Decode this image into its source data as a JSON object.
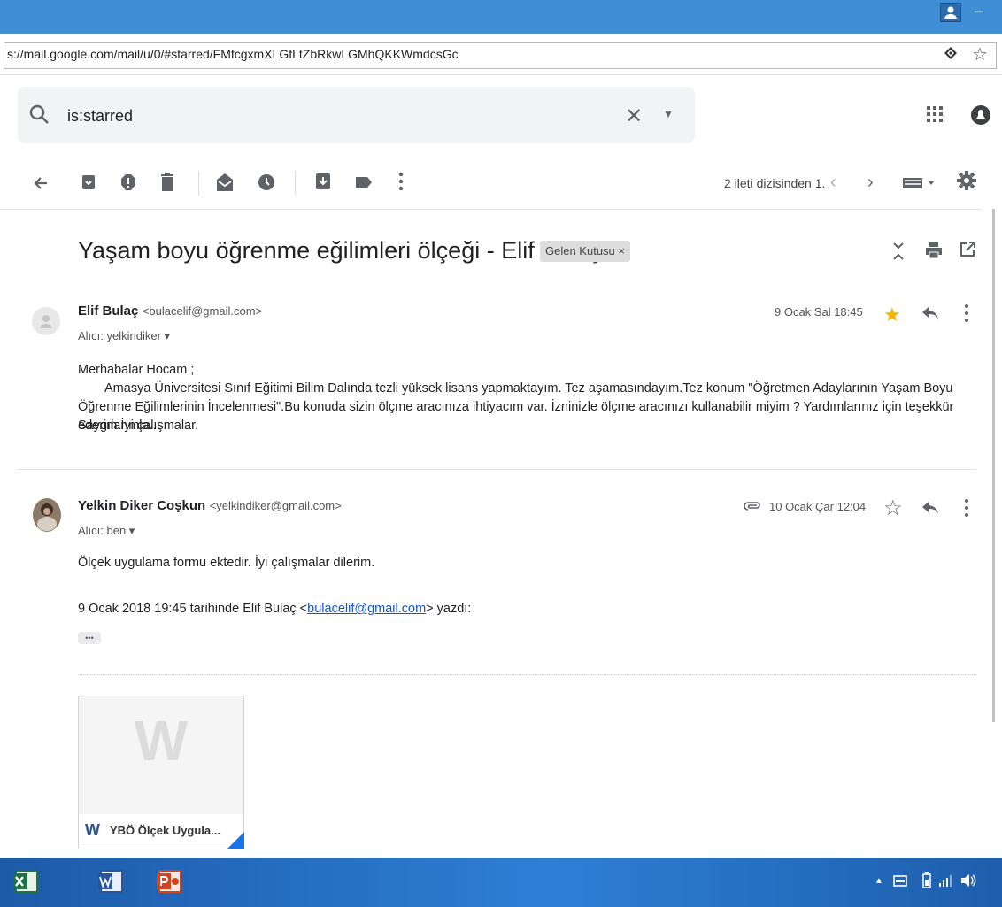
{
  "browser": {
    "url": "s://mail.google.com/mail/u/0/#starred/FMfcgxmXLGfLtZbRkwLGMhQKKWmdcsGc"
  },
  "search": {
    "query": "is:starred"
  },
  "toolbar": {
    "pager": "2 ileti dizisinden 1.",
    "prev": "‹",
    "next": "›"
  },
  "thread": {
    "subject": "Yaşam boyu öğrenme eğilimleri ölçeği - Elif Bulaç",
    "label": "Gelen Kutusu ×"
  },
  "messages": [
    {
      "sender_name": "Elif Bulaç",
      "sender_email": "<bulacelif@gmail.com>",
      "recipient": "Alıcı: yelkindiker ▾",
      "date": "9 Ocak Sal 18:45",
      "starred": true,
      "body": [
        "Merhabalar Hocam ;",
        "Amasya Üniversitesi Sınıf Eğitimi Bilim Dalında tezli yüksek lisans yapmaktayım. Tez aşamasındayım.Tez konum \"Öğretmen Adaylarının Yaşam Boyu Öğrenme Eğilimlerinin İncelenmesi\".Bu konuda sizin ölçme aracınıza ihtiyacım var. İzninizle ölçme aracınızı kullanabilir miyim ? Yardımlarınız için teşekkür ederim.İyi çalışmalar.",
        "Saygılarımla..."
      ]
    },
    {
      "sender_name": "Yelkin Diker Coşkun",
      "sender_email": "<yelkindiker@gmail.com>",
      "recipient": "Alıcı: ben ▾",
      "date": "10 Ocak Çar 12:04",
      "starred": false,
      "body": [
        "Ölçek uygulama formu ektedir. İyi çalışmalar dilerim."
      ],
      "quote_prefix": "9 Ocak 2018 19:45 tarihinde Elif Bulaç <",
      "quote_link": "bulacelif@gmail.com",
      "quote_suffix": "> yazdı:",
      "ellipsis": "•••",
      "attachment": {
        "name": "YBÖ Ölçek Uygula...",
        "preview_letter": "W",
        "type_letter": "W"
      }
    }
  ],
  "colors": {
    "star": "#f4b400",
    "link": "#1155cc",
    "taskbar": "#2d7fd6"
  }
}
